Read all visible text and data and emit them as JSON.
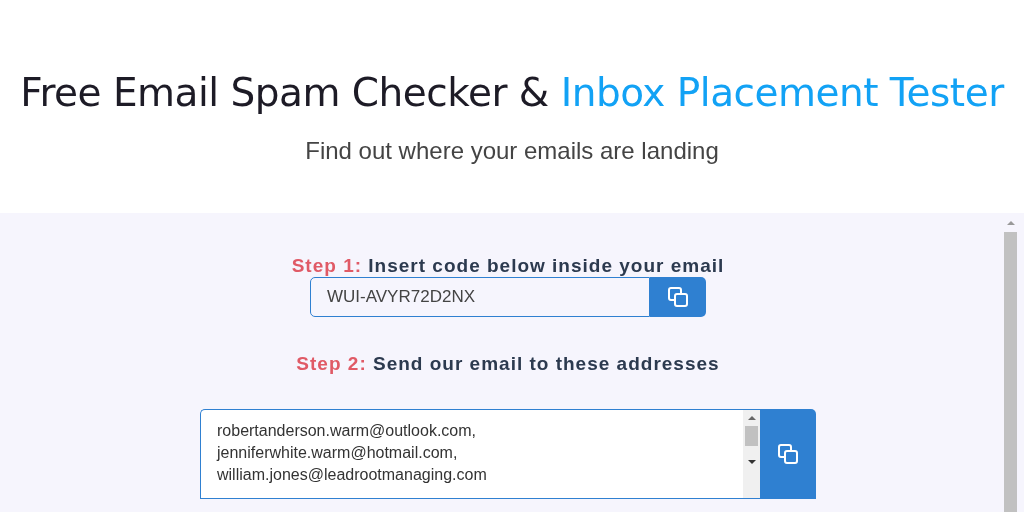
{
  "header": {
    "title": "Free Email Spam Checker & ",
    "title_highlight": "Inbox Placement Tester",
    "subtitle": "Find out where your emails are landing"
  },
  "steps": [
    {
      "label": "Step 1:",
      "text": "Insert code below inside your email",
      "kind": "code",
      "value": "WUI-AVYR72D2NX"
    },
    {
      "label": "Step 2:",
      "text": "Send our email to these addresses",
      "kind": "list",
      "lines": [
        "robertanderson.warm@outlook.com,",
        "jenniferwhite.warm@hotmail.com,",
        "william.jones@leadrootmanaging.com"
      ]
    }
  ]
}
